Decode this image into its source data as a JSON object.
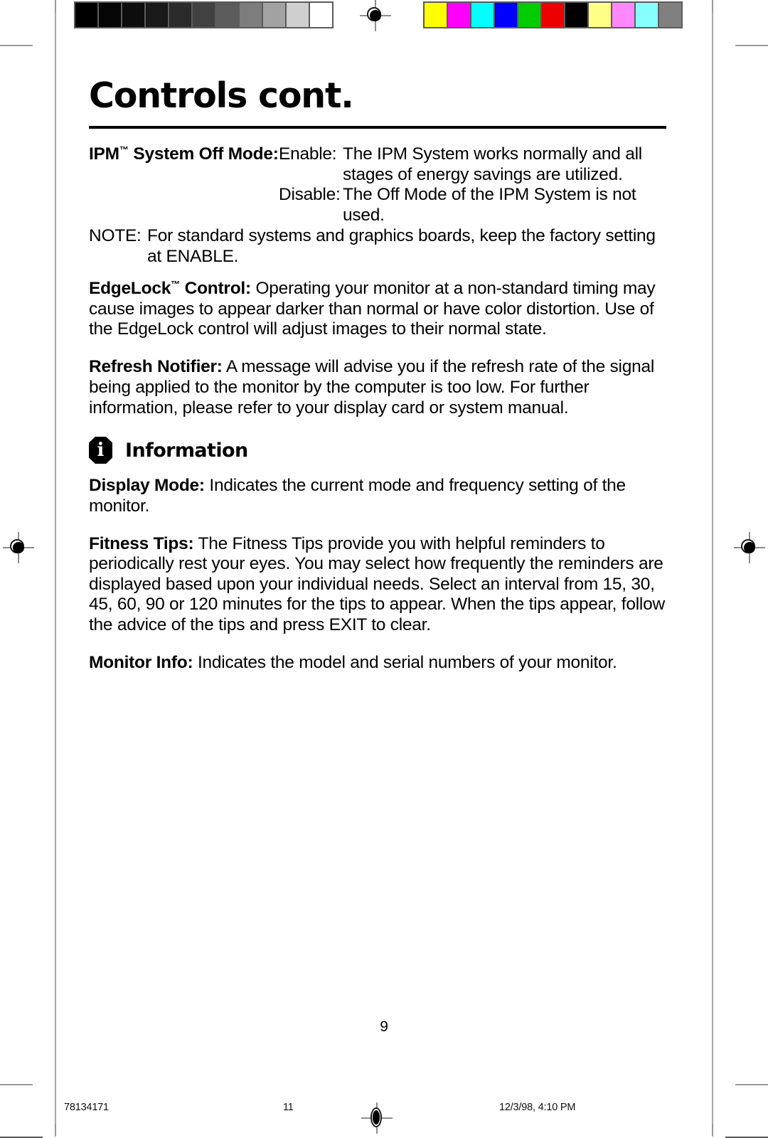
{
  "document": {
    "title": "Controls cont.",
    "folio": "9"
  },
  "calibration": {
    "grayscale_bar": {
      "name": "grayscale-step-wedge",
      "swatches": [
        "#000000",
        "#050505",
        "#0d0d0d",
        "#1a1a1a",
        "#2b2b2b",
        "#414141",
        "#5c5c5c",
        "#7d7d7d",
        "#a2a2a2",
        "#cfcfcf",
        "#ffffff"
      ]
    },
    "color_bar": {
      "name": "process-color-bar",
      "swatches": [
        "#ffff00",
        "#ff00ff",
        "#00ffff",
        "#0000ff",
        "#00cc00",
        "#ee0000",
        "#000000",
        "#ffff88",
        "#ff88ff",
        "#88ffff",
        "#808080"
      ]
    }
  },
  "sections": {
    "ipm": {
      "term": "IPM",
      "term_tm": "™",
      "term_rest": " System Off Mode:",
      "enable_label": "Enable:",
      "enable_text": "The IPM System works normally and all stages of energy savings are utilized.",
      "disable_label": "Disable:",
      "disable_text": "The Off Mode of the IPM System is not used.",
      "note_label": "NOTE:",
      "note_text": "For standard systems and graphics boards, keep the factory setting",
      "note_text_cont": "at ENABLE."
    },
    "edgelock": {
      "term": "EdgeLock",
      "term_tm": "™",
      "term_rest": " Control:",
      "body": "  Operating your monitor at a non-standard timing may cause images to appear darker than normal or have color distortion. Use of the EdgeLock control will adjust images to their normal state."
    },
    "refresh_notifier": {
      "term": "Refresh Notifier:",
      "body": " A message will advise you if the refresh rate of the signal being applied to the monitor by the computer is too low. For further information, please refer to your display card or system manual."
    },
    "information": {
      "icon": "info-icon",
      "icon_glyph": "i",
      "heading": "Information",
      "items": [
        {
          "term": "Display Mode:",
          "body": " Indicates the current mode and frequency setting of the monitor."
        },
        {
          "term": "Fitness Tips:",
          "body": " The Fitness Tips provide you with helpful reminders to periodically rest your eyes. You may select how frequently the reminders are displayed based upon your individual needs. Select an interval from 15, 30, 45, 60, 90 or 120 minutes for the tips to appear. When the tips appear, follow the advice of the tips and press EXIT to clear."
        },
        {
          "term": "Monitor Info:",
          "body": " Indicates the model and serial numbers of your monitor."
        }
      ]
    }
  },
  "print_footer": {
    "job_number": "78134171",
    "sheet_number": "11",
    "timestamp": "12/3/98, 4:10 PM"
  }
}
